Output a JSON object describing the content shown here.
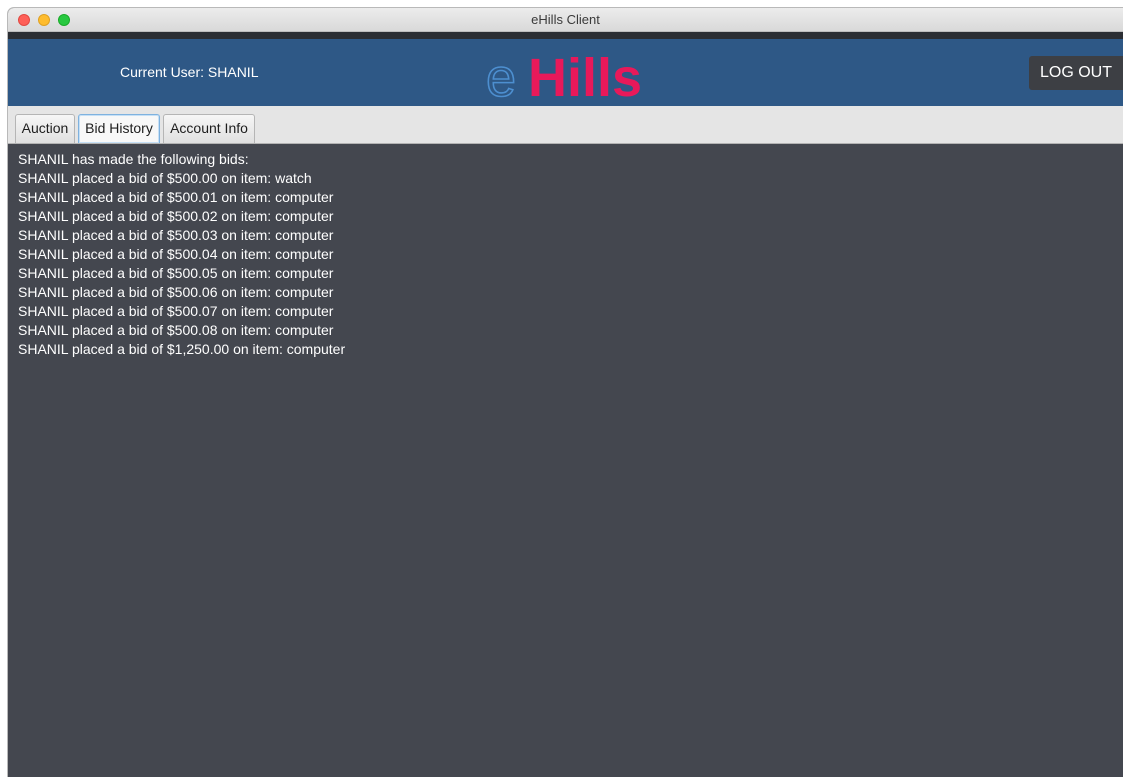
{
  "window": {
    "title": "eHills Client"
  },
  "header": {
    "current_user_label": "Current User: SHANIL",
    "logo_text": "eHills",
    "logo_prefix": "e",
    "logo_suffix": "Hills",
    "logout_label": "LOG OUT",
    "brand_color": "#2e5886",
    "logo_accent_color": "#e8195a"
  },
  "tabs": [
    {
      "label": "Auction",
      "active": false
    },
    {
      "label": "Bid History",
      "active": true
    },
    {
      "label": "Account Info",
      "active": false
    }
  ],
  "bid_history": {
    "heading": "SHANIL has made the following bids:",
    "lines": [
      "SHANIL placed a bid of $500.00 on item: watch",
      "SHANIL placed a bid of $500.01 on item: computer",
      "SHANIL placed a bid of $500.02 on item: computer",
      "SHANIL placed a bid of $500.03 on item: computer",
      "SHANIL placed a bid of $500.04 on item: computer",
      "SHANIL placed a bid of $500.05 on item: computer",
      "SHANIL placed a bid of $500.06 on item: computer",
      "SHANIL placed a bid of $500.07 on item: computer",
      "SHANIL placed a bid of $500.08 on item: computer",
      "SHANIL placed a bid of $1,250.00 on item: computer"
    ]
  }
}
